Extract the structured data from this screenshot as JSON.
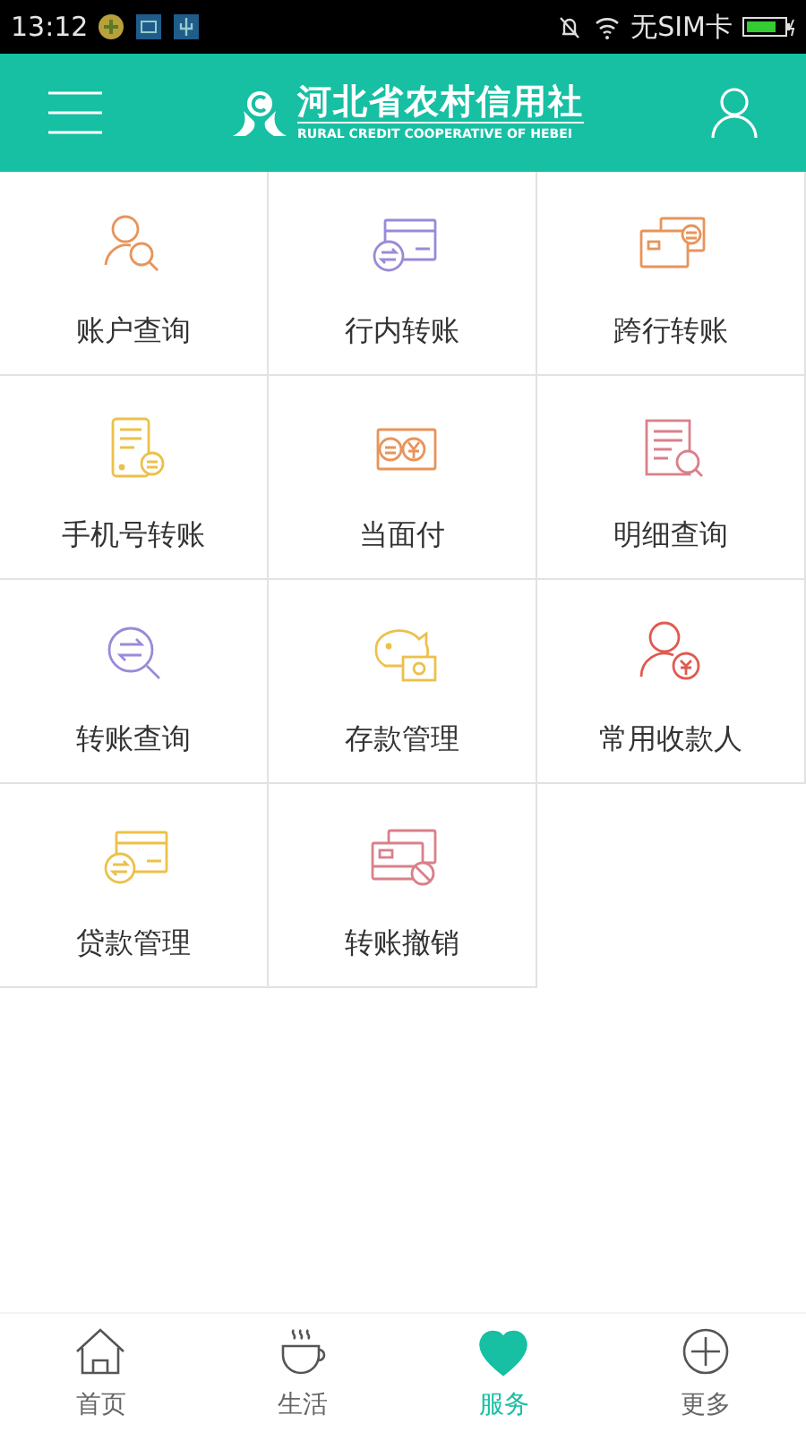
{
  "status_bar": {
    "time": "13:12",
    "carrier": "无SIM卡"
  },
  "header": {
    "title": "河北省农村信用社",
    "subtitle": "RURAL CREDIT COOPERATIVE OF HEBEI"
  },
  "services": [
    {
      "label": "账户查询",
      "kind": "person-search",
      "color": "#e8945a"
    },
    {
      "label": "行内转账",
      "kind": "card-transfer",
      "color": "#9b8ad8"
    },
    {
      "label": "跨行转账",
      "kind": "two-cards",
      "color": "#e8945a"
    },
    {
      "label": "手机号转账",
      "kind": "phone",
      "color": "#ecc14a"
    },
    {
      "label": "当面付",
      "kind": "cash",
      "color": "#e8945a"
    },
    {
      "label": "明细查询",
      "kind": "document-search",
      "color": "#d9808a"
    },
    {
      "label": "转账查询",
      "kind": "transfer-search",
      "color": "#9b8ad8"
    },
    {
      "label": "存款管理",
      "kind": "piggy",
      "color": "#ecc14a"
    },
    {
      "label": "常用收款人",
      "kind": "person-coin",
      "color": "#e05a50"
    },
    {
      "label": "贷款管理",
      "kind": "card-transfer",
      "color": "#ecc14a"
    },
    {
      "label": "转账撤销",
      "kind": "card-cancel",
      "color": "#d9808a"
    }
  ],
  "tabs": [
    {
      "label": "首页",
      "kind": "house",
      "selected": false
    },
    {
      "label": "生活",
      "kind": "cup",
      "selected": false
    },
    {
      "label": "服务",
      "kind": "heart",
      "selected": true
    },
    {
      "label": "更多",
      "kind": "plus",
      "selected": false
    }
  ]
}
